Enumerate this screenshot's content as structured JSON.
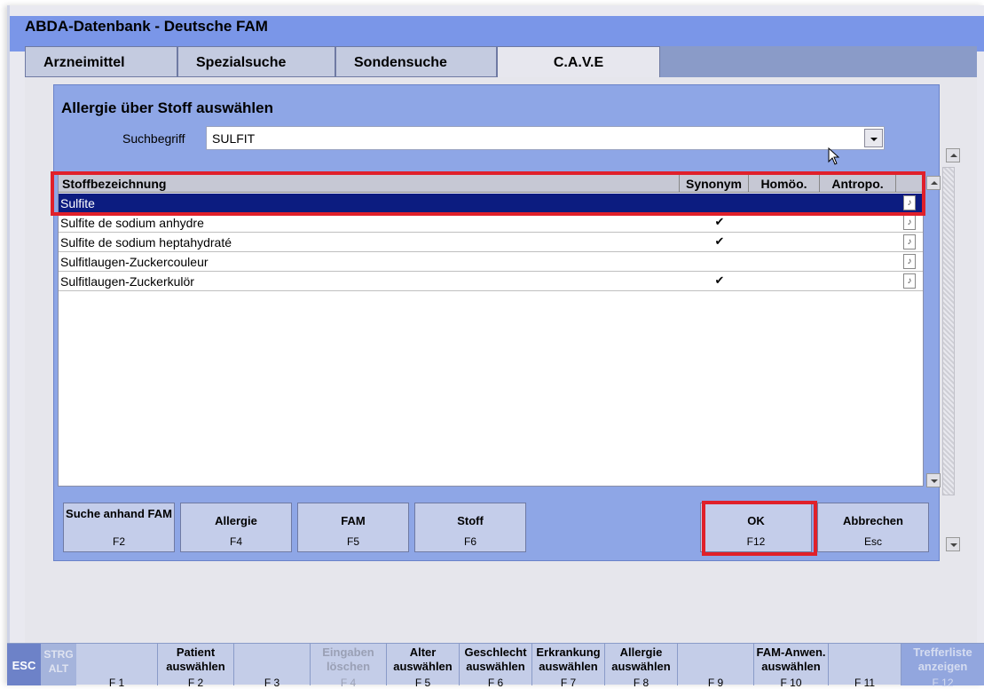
{
  "app": {
    "title": "ABDA-Datenbank  - Deutsche FAM"
  },
  "tabs": [
    {
      "label": "Arzneimittel"
    },
    {
      "label": "Spezialsuche"
    },
    {
      "label": "Sondensuche"
    },
    {
      "label": "C.A.V.E"
    }
  ],
  "dialog": {
    "title": "Allergie über Stoff auswählen",
    "search_label": "Suchbegriff",
    "search_value": "SULFIT"
  },
  "grid": {
    "columns": [
      "Stoffbezeichnung",
      "Synonym",
      "Homöo.",
      "Antropo."
    ],
    "rows": [
      {
        "name": "Sulfite",
        "synonym": "",
        "selected": true
      },
      {
        "name": "Sulfite de sodium anhydre",
        "synonym": "✔"
      },
      {
        "name": "Sulfite de sodium heptahydraté",
        "synonym": "✔"
      },
      {
        "name": "Sulfitlaugen-Zuckercouleur",
        "synonym": ""
      },
      {
        "name": "Sulfitlaugen-Zuckerkulör",
        "synonym": "✔"
      }
    ],
    "note_icon": "note-icon"
  },
  "buttons": [
    {
      "label": "Suche anhand FAM",
      "key": "F2"
    },
    {
      "label": "Allergie",
      "key": "F4"
    },
    {
      "label": "FAM",
      "key": "F5"
    },
    {
      "label": "Stoff",
      "key": "F6"
    },
    {
      "label": "OK",
      "key": "F12"
    },
    {
      "label": "Abbrechen",
      "key": "Esc"
    }
  ],
  "fkeys": {
    "esc": "ESC",
    "strg": "STRG",
    "alt": "ALT",
    "items": [
      {
        "label": "",
        "key": "F 1"
      },
      {
        "label": "Patient auswählen",
        "key": "F 2"
      },
      {
        "label": "",
        "key": "F 3"
      },
      {
        "label": "Eingaben löschen",
        "key": "F 4",
        "disabled": true
      },
      {
        "label": "Alter auswählen",
        "key": "F 5"
      },
      {
        "label": "Geschlecht auswählen",
        "key": "F 6"
      },
      {
        "label": "Erkrankung auswählen",
        "key": "F 7"
      },
      {
        "label": "Allergie auswählen",
        "key": "F 8"
      },
      {
        "label": "",
        "key": "F 9"
      },
      {
        "label": "FAM-Anwen. auswählen",
        "key": "F 10"
      },
      {
        "label": "",
        "key": "F 11"
      },
      {
        "label": "Trefferliste anzeigen",
        "key": "F 12",
        "disabled": true
      }
    ]
  },
  "colors": {
    "title_bar": "#7a96e8",
    "dialog": "#8ea6e6",
    "selection": "#0c1c80",
    "highlight": "#e0202a"
  }
}
